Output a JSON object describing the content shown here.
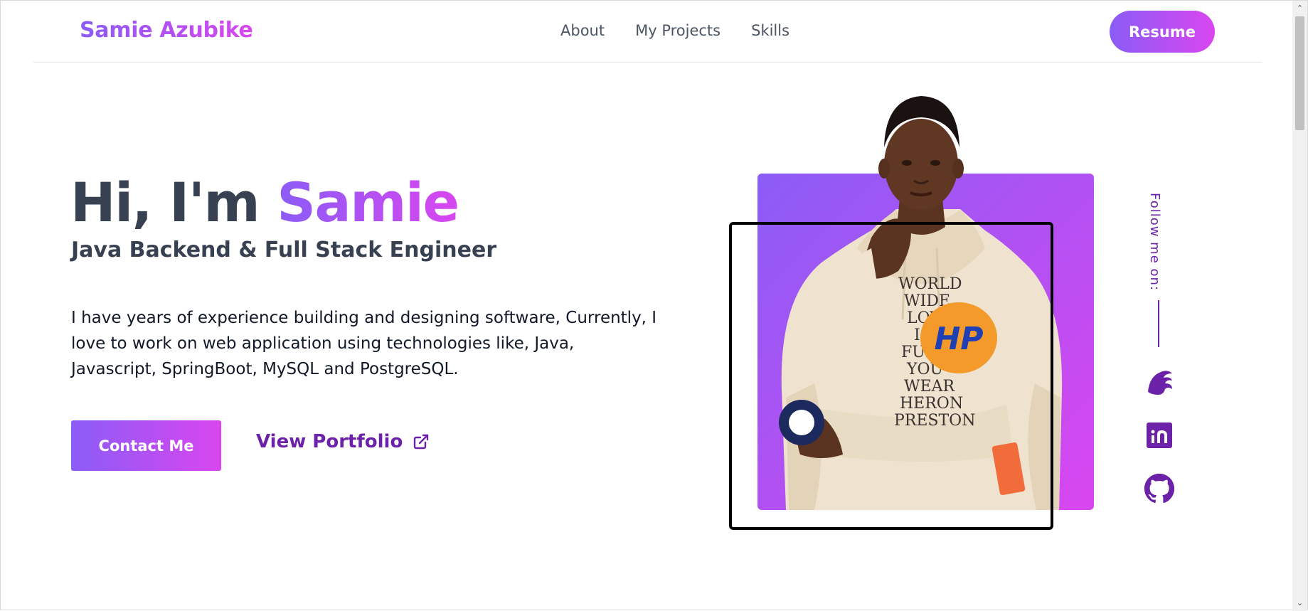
{
  "header": {
    "logo": "Samie Azubike",
    "nav": [
      "About",
      "My Projects",
      "Skills"
    ],
    "resume_label": "Resume"
  },
  "hero": {
    "greeting": "Hi, I'm ",
    "name": "Samie",
    "subtitle": "Java Backend & Full Stack Engineer",
    "description": "I have years of experience building and designing software, Currently, I love to work on web application using technologies like, Java, Javascript, SpringBoot, MySQL and PostgreSQL.",
    "contact_label": "Contact Me",
    "portfolio_label": "View Portfolio"
  },
  "portrait": {
    "shirt_lines": [
      "WORLD",
      "WIDE",
      "LOVE",
      "IS",
      "FUL",
      "YOU",
      "WEAR",
      "HERON",
      "PRESTON"
    ],
    "badge": "HP"
  },
  "social": {
    "follow_label": "Follow me on:",
    "icons": [
      "hashnode-icon",
      "indeed-icon",
      "github-icon"
    ]
  },
  "scroll": {
    "up": "⌃",
    "down": "⌄"
  },
  "colors": {
    "accent_start": "#8b5cf6",
    "accent_end": "#d946ef",
    "dark_text": "#374151",
    "purple_text": "#6b21a8"
  }
}
